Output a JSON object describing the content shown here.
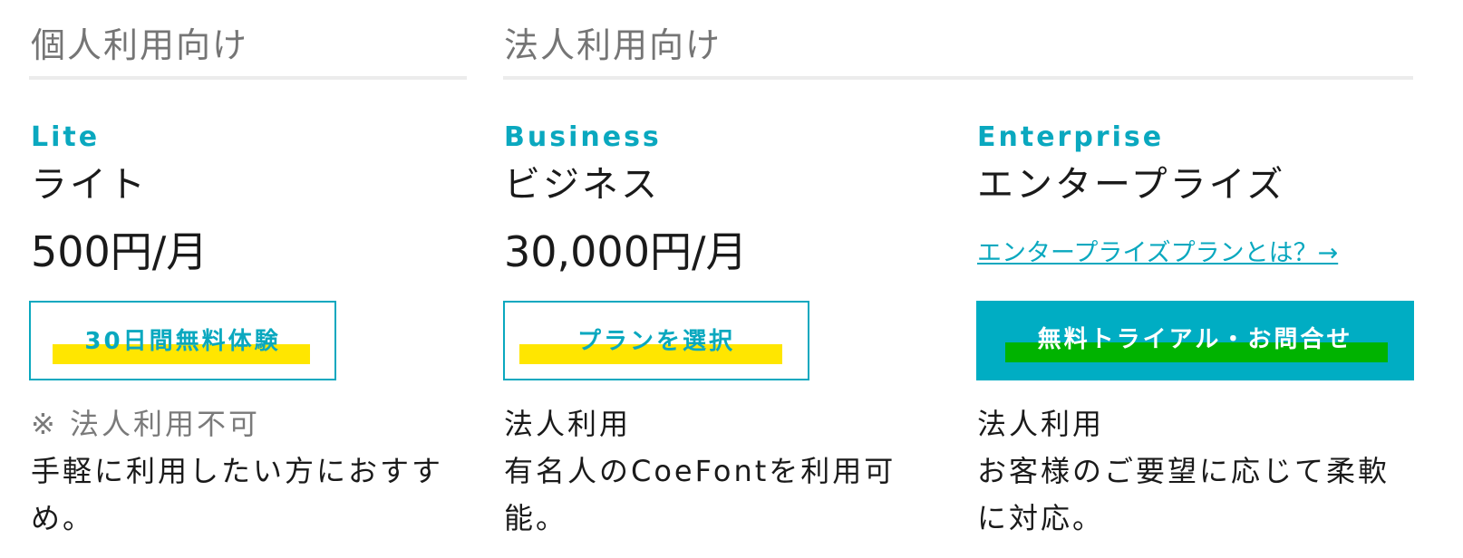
{
  "sections": {
    "personal": {
      "title": "個人利用向け"
    },
    "corporate": {
      "title": "法人利用向け"
    }
  },
  "plans": [
    {
      "name_en": "Lite",
      "name_ja": "ライト",
      "price": "500円/月",
      "cta_label": "30日間無料体験",
      "note": "※ 法人利用不可",
      "description": "手軽に利用したい方におすすめ。"
    },
    {
      "name_en": "Business",
      "name_ja": "ビジネス",
      "price": "30,000円/月",
      "cta_label": "プランを選択",
      "note": "法人利用",
      "description": "有名人のCoeFontを利用可能。"
    },
    {
      "name_en": "Enterprise",
      "name_ja": "エンタープライズ",
      "link_label": "エンタープライズプランとは？→",
      "cta_label": "無料トライアル・お問合せ",
      "note": "法人利用",
      "description": "お客様のご要望に応じて柔軟に対応。"
    }
  ],
  "colors": {
    "accent": "#0aa8bf",
    "cta_solid_bg": "#00adc3",
    "highlight_yellow": "#ffe600",
    "highlight_green": "#00b300",
    "muted_text": "#757575",
    "divider": "#ececec"
  }
}
